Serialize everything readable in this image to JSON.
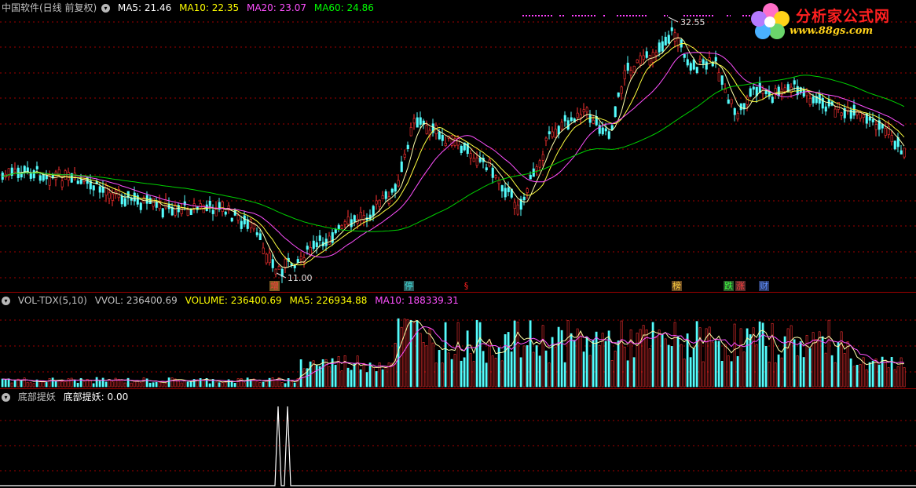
{
  "main": {
    "title": "中国软件(日线 前复权)",
    "ma5": "MA5: 21.46",
    "ma10": "MA10: 22.35",
    "ma20": "MA20: 23.07",
    "ma60": "MA60: 24.86",
    "high_label": "32.55",
    "low_label": "11.00",
    "markers": [
      {
        "label": "增",
        "color": "#ff4040",
        "bg": "#7a5a20"
      },
      {
        "label": "停",
        "color": "#40e0e0",
        "bg": "#2a5a5a"
      },
      {
        "label": "§",
        "color": "#ff2020",
        "bg": ""
      },
      {
        "label": "榜",
        "color": "#ffd040",
        "bg": "#6a4a20"
      },
      {
        "label": "跌",
        "color": "#40ff40",
        "bg": "#2a5a2a"
      },
      {
        "label": "涨",
        "color": "#ff4040",
        "bg": "#5a2a2a"
      },
      {
        "label": "财",
        "color": "#6090ff",
        "bg": "#2a3a6a"
      }
    ]
  },
  "volume": {
    "name": "VOL-TDX(5,10)",
    "vvol": "VVOL: 236400.69",
    "volume": "VOLUME: 236400.69",
    "ma5": "MA5: 226934.88",
    "ma10": "MA10: 188339.31"
  },
  "indicator": {
    "name": "底部提妖",
    "value": "底部提妖: 0.00"
  },
  "logo": {
    "brand": "分析家公式网",
    "url": "www.88gs.com"
  },
  "colors": {
    "up": "#ff3232",
    "down": "#54fcfc",
    "ma5": "#ffffaa",
    "ma10": "#ff50ff",
    "ma20": "#ff50ff",
    "ma60": "#00d000",
    "grid": "#a00000"
  }
}
